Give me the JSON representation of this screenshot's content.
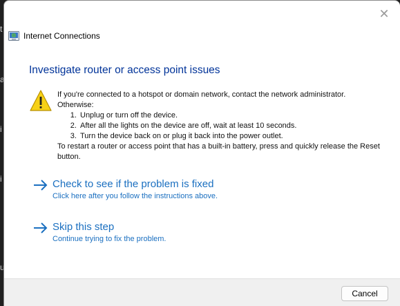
{
  "background": {
    "fragments": [
      "t",
      "a",
      "i",
      "i",
      "u"
    ]
  },
  "dialog": {
    "app_title": "Internet Connections",
    "close_glyph": "✕",
    "heading": "Investigate router or access point issues",
    "warning": {
      "icon": "warning-icon",
      "intro": "If you're connected to a hotspot or domain network, contact the network administrator.",
      "otherwise": "Otherwise:",
      "steps": [
        "Unplug or turn off the device.",
        "After all the lights on the device are off, wait at least 10 seconds.",
        "Turn the device back on or plug it back into the power outlet."
      ],
      "outro": "To restart a router or access point that has a built-in battery, press and quickly release the Reset button."
    },
    "commands": [
      {
        "title": "Check to see if the problem is fixed",
        "subtitle": "Click here after you follow the instructions above."
      },
      {
        "title": "Skip this step",
        "subtitle": "Continue trying to fix the problem."
      }
    ],
    "cancel_label": "Cancel"
  },
  "colors": {
    "heading": "#003399",
    "link": "#1a6fc0",
    "footer_bg": "#f0f0f0"
  }
}
